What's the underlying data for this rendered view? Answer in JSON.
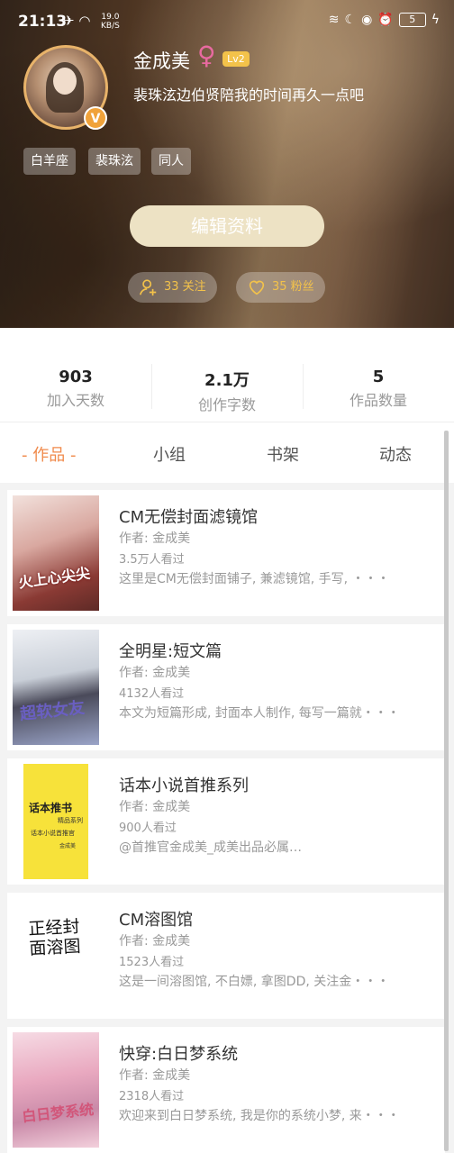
{
  "status_bar": {
    "time": "21:13",
    "net_speed": "19.0",
    "net_unit": "KB/S",
    "battery": "5"
  },
  "profile": {
    "name": "金成美",
    "level": "Lv2",
    "signature": "裴珠泫边伯贤陪我的时间再久一点吧",
    "verified_badge": "V",
    "tags": [
      "白羊座",
      "裴珠泫",
      "同人"
    ],
    "edit_button": "编辑资料",
    "following_label": "33 关注",
    "followers_label": "35 粉丝"
  },
  "stats": [
    {
      "value": "903",
      "label": "加入天数"
    },
    {
      "value": "2.1万",
      "label": "创作字数"
    },
    {
      "value": "5",
      "label": "作品数量"
    }
  ],
  "tabs": [
    "- 作品 -",
    "小组",
    "书架",
    "动态"
  ],
  "works": [
    {
      "title": "CM无偿封面滤镜馆",
      "author": "作者: 金成美",
      "views": "3.5万人看过",
      "desc": "这里是CM无偿封面铺子, 兼滤镜馆, 手写, ・・・",
      "cover_text": "火上心尖尖"
    },
    {
      "title": "全明星:短文篇",
      "author": "作者: 金成美",
      "views": "4132人看过",
      "desc": "本文为短篇形成, 封面本人制作, 每写一篇就・・・",
      "cover_text": "超软女友"
    },
    {
      "title": "话本小说首推系列",
      "author": "作者: 金成美",
      "views": "900人看过",
      "desc": "@首推官金成美_成美出品必属…",
      "cover_text": "话本推书",
      "cover_sub1": "精品系列",
      "cover_sub2": "话本小说首推官",
      "cover_sub3": "金成美"
    },
    {
      "title": "CM溶图馆",
      "author": "作者: 金成美",
      "views": "1523人看过",
      "desc": "这是一间溶图馆, 不白嫖, 拿图DD, 关注金・・・",
      "cover_text": "正经封面溶图"
    },
    {
      "title": "快穿:白日梦系统",
      "author": "作者: 金成美",
      "views": "2318人看过",
      "desc": "欢迎来到白日梦系统, 我是你的系统小梦, 来・・・",
      "cover_text": "白日梦系统"
    }
  ],
  "colors": {
    "accent": "#f08a4b",
    "gold": "#f3c24a",
    "edit_button": "#ede2c4"
  }
}
